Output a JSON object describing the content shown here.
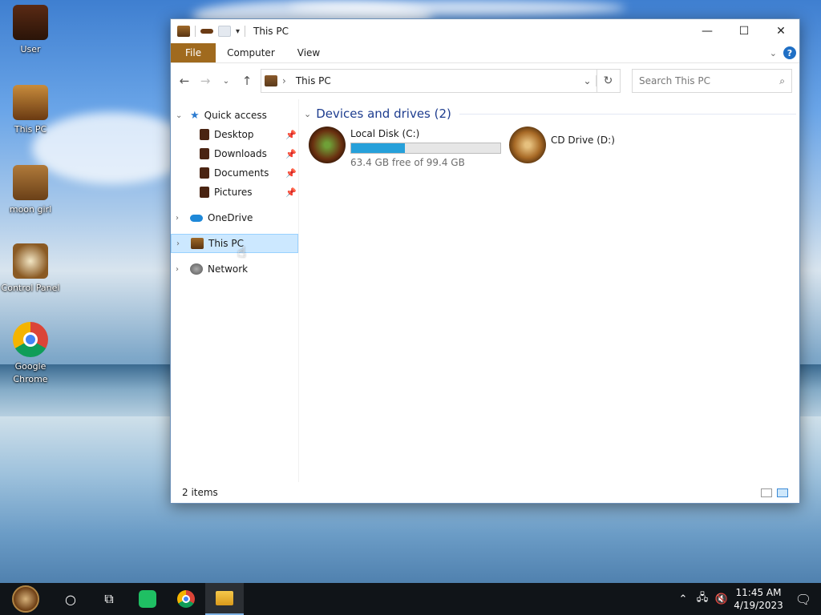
{
  "desktop": {
    "icons": [
      {
        "label": "User",
        "icon": "user-folder-icon"
      },
      {
        "label": "This PC",
        "icon": "this-pc-icon"
      },
      {
        "label": "moon girl",
        "icon": "moon-girl-folder-icon"
      },
      {
        "label": "Control Panel",
        "icon": "control-panel-icon"
      },
      {
        "label": "Google Chrome",
        "icon": "chrome-icon"
      }
    ]
  },
  "window": {
    "title": "This PC",
    "controls": {
      "minimize": "—",
      "maximize": "☐",
      "close": "✕"
    },
    "ribbon": {
      "tabs": [
        "File",
        "Computer",
        "View"
      ],
      "help": "?"
    },
    "address": {
      "path": "This PC"
    },
    "search": {
      "placeholder": "Search This PC"
    },
    "nav": {
      "quick_access": "Quick access",
      "quick_items": [
        "Desktop",
        "Downloads",
        "Documents",
        "Pictures"
      ],
      "onedrive": "OneDrive",
      "this_pc": "This PC",
      "network": "Network"
    },
    "content": {
      "group_title": "Devices and drives (2)",
      "drives": [
        {
          "name": "Local Disk (C:)",
          "free_text": "63.4 GB free of 99.4 GB",
          "used_fraction": 0.36
        },
        {
          "name": "CD Drive (D:)"
        }
      ]
    },
    "status": {
      "items": "2 items"
    }
  },
  "taskbar": {
    "clock_time": "11:45 AM",
    "clock_date": "4/19/2023"
  },
  "colors": {
    "accent": "#26a0da",
    "file_tab": "#a06a1e",
    "group_title": "#1e3d8f"
  }
}
